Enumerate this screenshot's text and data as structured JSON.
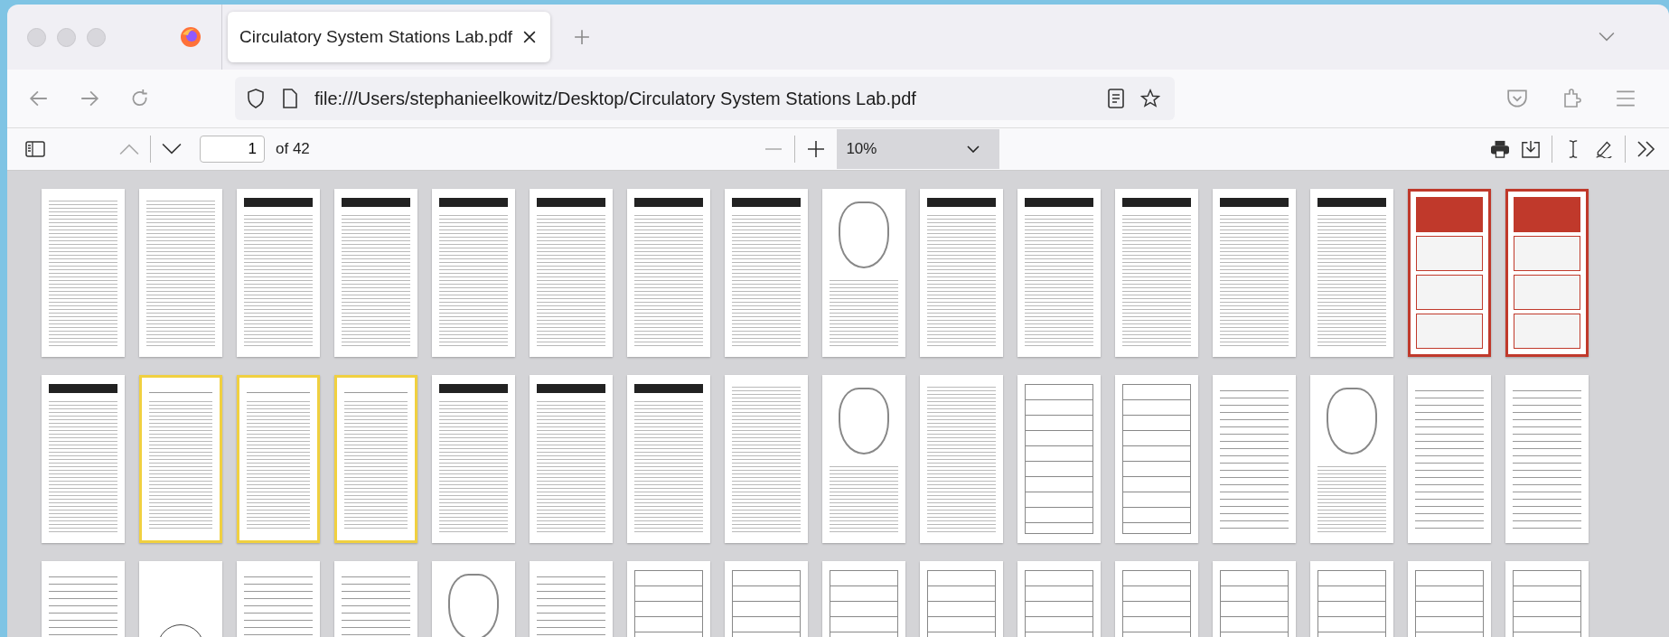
{
  "tab": {
    "title": "Circulatory System Stations Lab.pdf",
    "selected": true
  },
  "address": {
    "url": "file:///Users/stephanieelkowitz/Desktop/Circulatory System Stations Lab.pdf"
  },
  "pdf_toolbar": {
    "page": "1",
    "page_count": "of 42",
    "zoom": "10%"
  },
  "thumbnails": [
    {
      "kind": "text"
    },
    {
      "kind": "text"
    },
    {
      "kind": "station"
    },
    {
      "kind": "station"
    },
    {
      "kind": "station"
    },
    {
      "kind": "station"
    },
    {
      "kind": "station"
    },
    {
      "kind": "station"
    },
    {
      "kind": "diagram"
    },
    {
      "kind": "station"
    },
    {
      "kind": "station"
    },
    {
      "kind": "station"
    },
    {
      "kind": "station"
    },
    {
      "kind": "station"
    },
    {
      "kind": "card"
    },
    {
      "kind": "card"
    },
    {
      "kind": "station"
    },
    {
      "kind": "case"
    },
    {
      "kind": "case"
    },
    {
      "kind": "case"
    },
    {
      "kind": "station"
    },
    {
      "kind": "station"
    },
    {
      "kind": "station"
    },
    {
      "kind": "text"
    },
    {
      "kind": "diagram"
    },
    {
      "kind": "text"
    },
    {
      "kind": "form"
    },
    {
      "kind": "form"
    },
    {
      "kind": "lined"
    },
    {
      "kind": "diagram"
    },
    {
      "kind": "lined"
    },
    {
      "kind": "lined"
    },
    {
      "kind": "lined"
    },
    {
      "kind": "circle"
    },
    {
      "kind": "lined"
    },
    {
      "kind": "lined"
    },
    {
      "kind": "diagram"
    },
    {
      "kind": "lined"
    },
    {
      "kind": "form"
    },
    {
      "kind": "form"
    },
    {
      "kind": "form"
    },
    {
      "kind": "form"
    },
    {
      "kind": "form"
    },
    {
      "kind": "form"
    },
    {
      "kind": "form"
    },
    {
      "kind": "form"
    },
    {
      "kind": "form"
    },
    {
      "kind": "form"
    }
  ]
}
